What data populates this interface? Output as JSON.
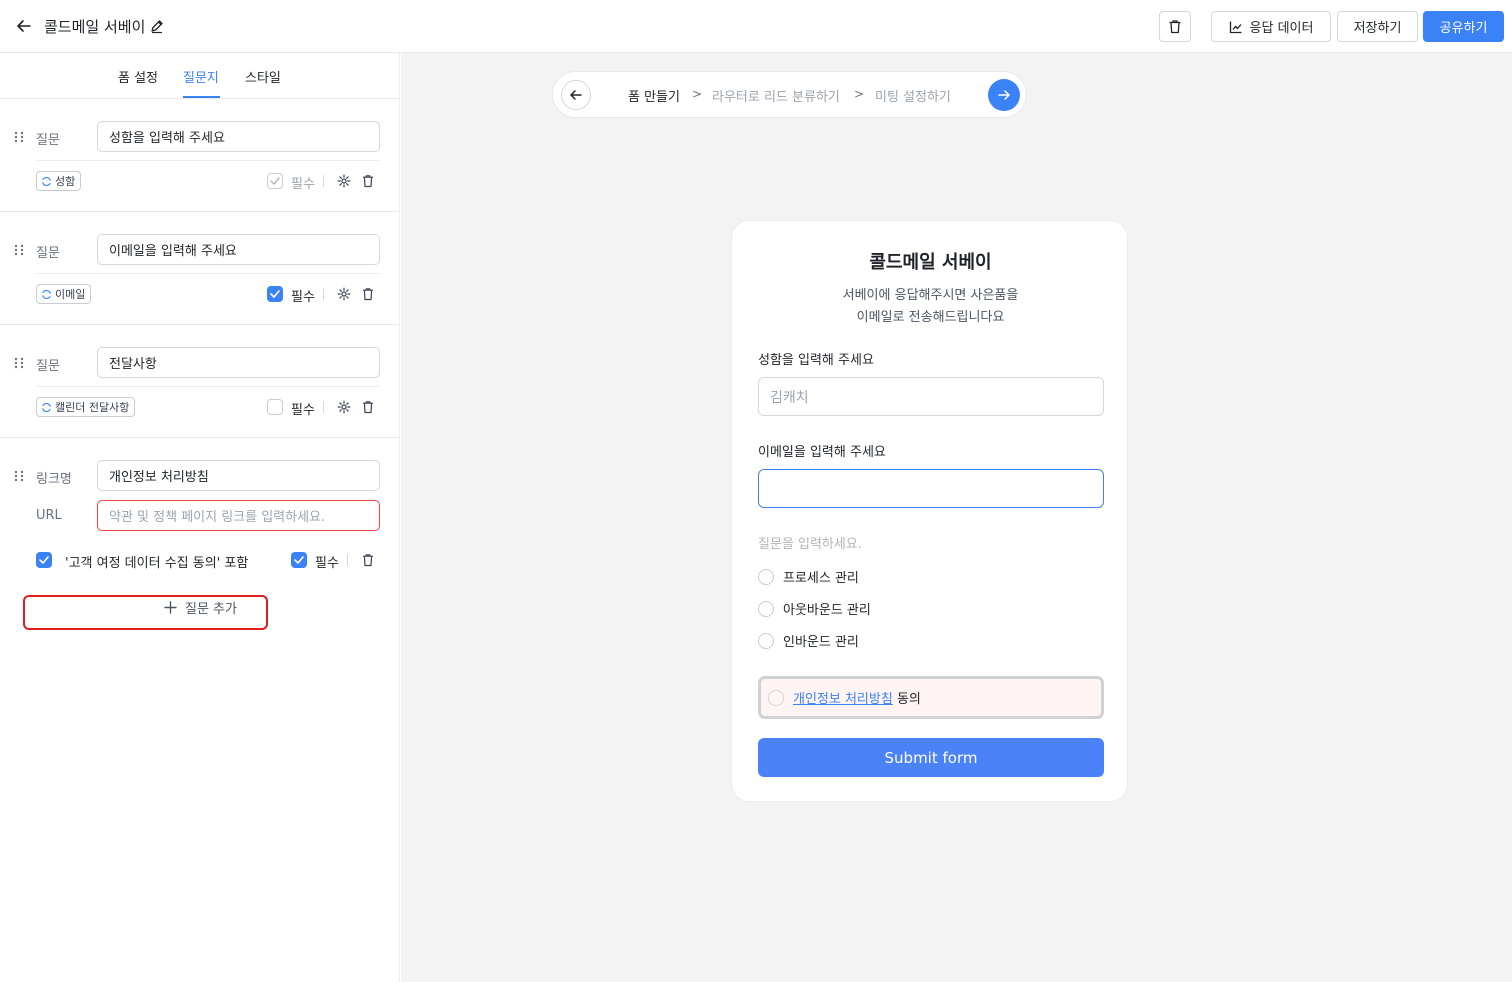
{
  "header": {
    "title": "콜드메일 서베이",
    "response_data_label": "응답 데이터",
    "save_label": "저장하기",
    "share_label": "공유하기"
  },
  "tabs": [
    {
      "label": "폼 설정",
      "active": false
    },
    {
      "label": "질문지",
      "active": true
    },
    {
      "label": "스타일",
      "active": false
    }
  ],
  "questions": [
    {
      "label": "질문",
      "value": "성함을 입력해 주세요",
      "chip": "성함",
      "required_label": "필수",
      "required": true,
      "required_disabled": true
    },
    {
      "label": "질문",
      "value": "이메일을 입력해 주세요",
      "chip": "이메일",
      "required_label": "필수",
      "required": true,
      "required_disabled": false
    },
    {
      "label": "질문",
      "value": "전달사항",
      "chip": "캘린더 전달사항",
      "required_label": "필수",
      "required": false,
      "required_disabled": false
    }
  ],
  "link_block": {
    "name_label": "링크명",
    "name_value": "개인정보 처리방침",
    "url_label": "URL",
    "url_placeholder": "약관 및 정책 페이지 링크를 입력하세요.",
    "consent_label": "'고객 여정 데이터 수집 동의' 포함",
    "required_label": "필수"
  },
  "add_question_label": "질문 추가",
  "stepper": {
    "steps": [
      "폼 만들기",
      "라우터로 리드 분류하기",
      "미팅 설정하기"
    ],
    "separator": ">"
  },
  "preview": {
    "title": "콜드메일 서베이",
    "description_line1": "서베이에 응답해주시면 사은품을",
    "description_line2": "이메일로 전송해드립니다요",
    "q1_label": "성함을 입력해 주세요",
    "q1_placeholder": "김캐치",
    "q2_label": "이메일을 입력해 주세요",
    "q3_placeholder": "질문을 입력하세요.",
    "options": [
      "프로세스 관리",
      "아웃바운드 관리",
      "인바운드 관리"
    ],
    "consent_link": "개인정보 처리방침",
    "consent_suffix": "동의",
    "submit_label": "Submit form"
  },
  "colors": {
    "accent": "#3b82f6",
    "error": "#ef4444",
    "highlight": "#e11d1d"
  }
}
